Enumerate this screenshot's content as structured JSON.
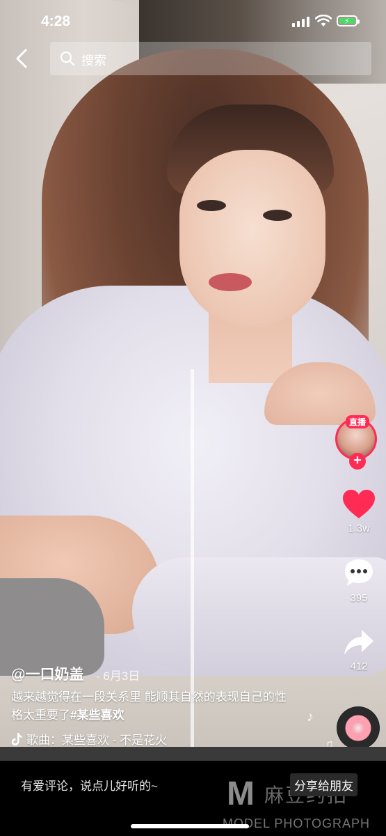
{
  "status_bar": {
    "time": "4:28"
  },
  "search": {
    "placeholder": "搜索"
  },
  "creator": {
    "live_badge": "直播",
    "follow_symbol": "+"
  },
  "actions": {
    "likes": "1.3w",
    "comments": "395",
    "shares": "412",
    "like_color": "#fe2c55"
  },
  "post": {
    "author": "@一口奶盖",
    "date": "· 6月3日",
    "caption": "越来越觉得在一段关系里 能顺其自然的表现自己的性格太重要了",
    "hashtag": "#某些喜欢",
    "song": "歌曲：某些喜欢 - 不是花火"
  },
  "bottom_bar": {
    "comment_placeholder": "有爱评论，说点儿好听的~",
    "share_to_friend": "分享给朋友"
  },
  "watermark": {
    "letter": "M",
    "name_cn": "麻豆约拍",
    "name_en": "MODEL PHOTOGRAPH"
  }
}
